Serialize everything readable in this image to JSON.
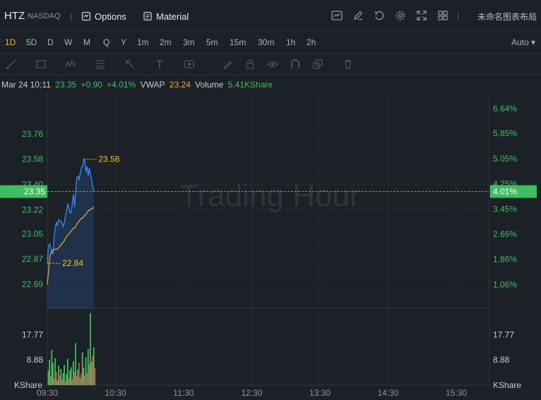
{
  "header": {
    "ticker": "HTZ",
    "exchange": "NASDAQ",
    "options_label": "Options",
    "material_label": "Material",
    "layout_name": "未命名图表布局"
  },
  "periods": [
    "1D",
    "5D",
    "D",
    "W",
    "M",
    "Q",
    "Y",
    "1m",
    "2m",
    "3m",
    "5m",
    "15m",
    "30m",
    "1h",
    "2h"
  ],
  "active_period": "1D",
  "auto_label": "Auto",
  "info": {
    "datetime": "Mar 24 10:11",
    "price": "23.35",
    "change": "+0.90",
    "change_pct": "+4.01%",
    "vwap_label": "VWAP",
    "vwap_value": "23.24",
    "volume_label": "Volume",
    "volume_value": "5.41KShare"
  },
  "colors": {
    "up": "#3fbd5f",
    "down": "#e0424b",
    "price_line": "#2f8cff",
    "vwap_line": "#f0a830",
    "marker": "#f0c419",
    "bg": "#1c2127"
  },
  "chart_data": {
    "type": "line",
    "watermark": "Trading Hour",
    "x_ticks": [
      "09:30",
      "10:30",
      "11:30",
      "12:30",
      "13:30",
      "14:30",
      "15:30"
    ],
    "price_axis": {
      "ticks": [
        "23.76",
        "23.58",
        "23.40",
        "23.22",
        "23.05",
        "22.87",
        "22.69"
      ],
      "tick_values": [
        23.76,
        23.58,
        23.4,
        23.22,
        23.05,
        22.87,
        22.69
      ],
      "ylim": [
        22.52,
        24.06
      ]
    },
    "pct_axis": {
      "ticks": [
        "6.64%",
        "5.85%",
        "5.05%",
        "4.25%",
        "3.45%",
        "2.66%",
        "1.86%",
        "1.06%"
      ],
      "tick_values": [
        6.64,
        5.85,
        5.05,
        4.25,
        3.45,
        2.66,
        1.86,
        1.06
      ]
    },
    "current_price": "23.35",
    "current_pct": "4.01%",
    "current_value": 23.35,
    "high_label": "23.58",
    "high_value": 23.58,
    "low_label": "22.84",
    "low_value": 22.84,
    "series": [
      {
        "name": "Price",
        "x": [
          0,
          1,
          2,
          3,
          4,
          5,
          6,
          7,
          8,
          9,
          10,
          11,
          12,
          13,
          14,
          15,
          16,
          17,
          18,
          19,
          20,
          21,
          22,
          23,
          24,
          25,
          26,
          27,
          28,
          29,
          30,
          31,
          32,
          33,
          34,
          35,
          36,
          37,
          38,
          39,
          40,
          41
        ],
        "values": [
          22.84,
          22.96,
          22.98,
          22.95,
          22.93,
          22.9,
          23.03,
          23.1,
          23.13,
          23.11,
          23.15,
          23.14,
          23.14,
          23.12,
          23.1,
          23.13,
          23.18,
          23.22,
          23.26,
          23.24,
          23.2,
          23.2,
          23.27,
          23.33,
          23.24,
          23.35,
          23.45,
          23.46,
          23.43,
          23.48,
          23.52,
          23.53,
          23.58,
          23.57,
          23.49,
          23.53,
          23.46,
          23.52,
          23.47,
          23.44,
          23.38,
          23.35
        ]
      },
      {
        "name": "VWAP",
        "x": [
          0,
          1,
          2,
          3,
          4,
          5,
          6,
          7,
          8,
          9,
          10,
          11,
          12,
          13,
          14,
          15,
          16,
          17,
          18,
          19,
          20,
          21,
          22,
          23,
          24,
          25,
          26,
          27,
          28,
          29,
          30,
          31,
          32,
          33,
          34,
          35,
          36,
          37,
          38,
          39,
          40,
          41
        ],
        "values": [
          22.69,
          22.78,
          22.88,
          22.91,
          22.93,
          22.93,
          22.94,
          22.94,
          22.94,
          22.94,
          22.95,
          22.96,
          22.97,
          22.98,
          22.99,
          23.0,
          23.02,
          23.03,
          23.04,
          23.05,
          23.06,
          23.07,
          23.08,
          23.09,
          23.09,
          23.1,
          23.12,
          23.13,
          23.14,
          23.15,
          23.16,
          23.16,
          23.17,
          23.18,
          23.19,
          23.2,
          23.21,
          23.22,
          23.22,
          23.23,
          23.23,
          23.24
        ]
      }
    ],
    "volume": {
      "label": "KShare",
      "ticks": [
        "17.77",
        "8.88"
      ],
      "tick_values": [
        17.77,
        8.88
      ],
      "ylim": [
        0,
        27
      ],
      "values": [
        5.2,
        8.9,
        3.1,
        12.4,
        7.8,
        2.3,
        9.5,
        4.6,
        1.8,
        6.9,
        3.4,
        5.7,
        2.1,
        4.2,
        7.1,
        1.5,
        3.8,
        9.2,
        2.4,
        5.1,
        6.3,
        1.9,
        8.4,
        4.7,
        14.8,
        3.2,
        5.6,
        7.9,
        2.6,
        4.1,
        11.6,
        6.2,
        3.5,
        9.8,
        4.4,
        12.7,
        7.3,
        25.3,
        8.1,
        10.4,
        13.2,
        5.9
      ],
      "up": [
        true,
        true,
        false,
        true,
        true,
        false,
        true,
        false,
        true,
        true,
        false,
        true,
        false,
        true,
        true,
        false,
        true,
        true,
        false,
        true,
        true,
        false,
        true,
        false,
        true,
        false,
        true,
        false,
        true,
        false,
        true,
        true,
        false,
        true,
        false,
        true,
        false,
        true,
        true,
        false,
        true,
        false
      ]
    }
  }
}
